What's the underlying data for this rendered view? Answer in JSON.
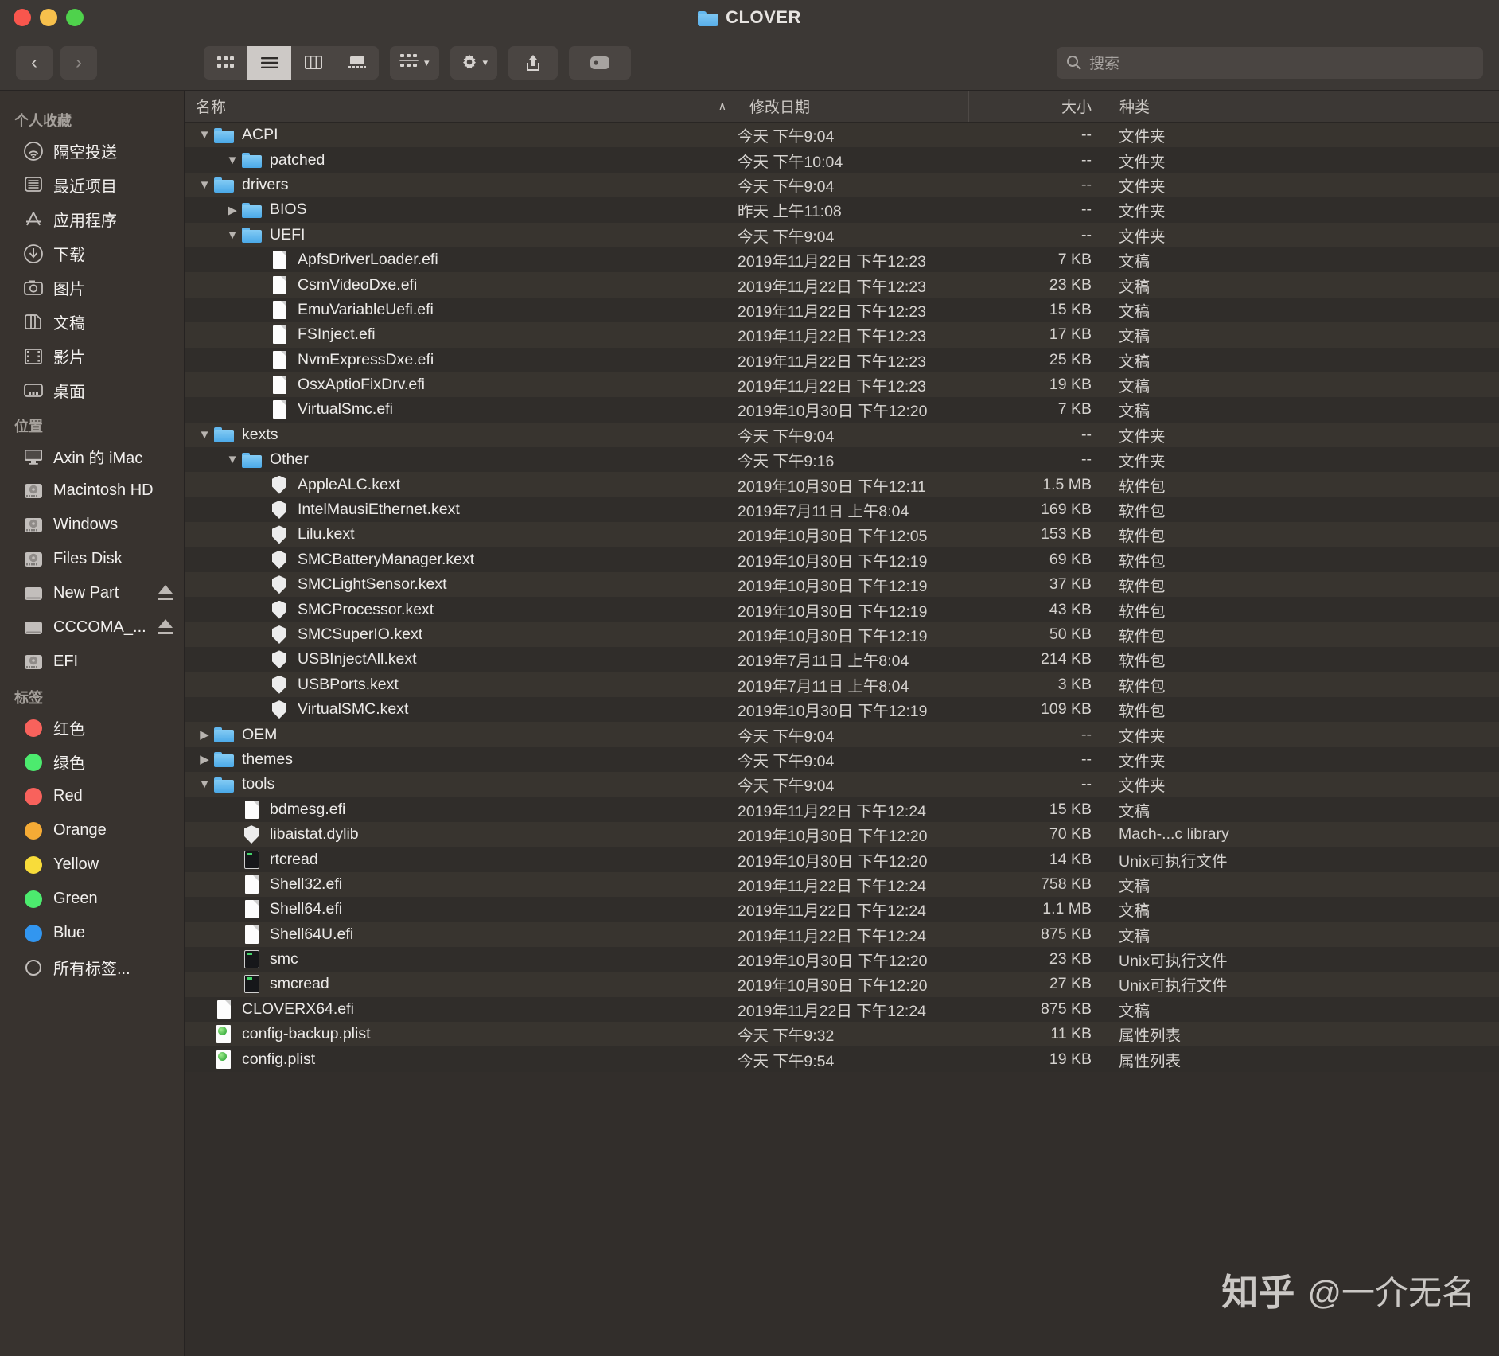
{
  "window": {
    "title": "CLOVER",
    "folder_icon": "folder-icon",
    "traffic_lights": [
      "close-red",
      "minimize-yellow",
      "maximize-green"
    ]
  },
  "toolbar": {
    "back_label": "‹",
    "forward_label": "›",
    "view_modes": [
      "icon-view",
      "list-view",
      "column-view",
      "gallery-view"
    ],
    "active_view": "list-view",
    "group_button": "group-by-button",
    "action_button": "action-gear-button",
    "share_button": "share-button",
    "tags_button": "tags-button",
    "search": {
      "placeholder": "搜索",
      "value": "",
      "icon": "search-icon"
    }
  },
  "sidebar": {
    "groups": [
      {
        "title": "个人收藏",
        "items": [
          {
            "label": "隔空投送",
            "icon": "airdrop-icon"
          },
          {
            "label": "最近项目",
            "icon": "recents-icon"
          },
          {
            "label": "应用程序",
            "icon": "applications-icon"
          },
          {
            "label": "下载",
            "icon": "downloads-icon"
          },
          {
            "label": "图片",
            "icon": "pictures-icon"
          },
          {
            "label": "文稿",
            "icon": "documents-icon"
          },
          {
            "label": "影片",
            "icon": "movies-icon"
          },
          {
            "label": "桌面",
            "icon": "desktop-icon"
          }
        ]
      },
      {
        "title": "位置",
        "items": [
          {
            "label": "Axin 的 iMac",
            "icon": "imac-icon",
            "eject": false
          },
          {
            "label": "Macintosh HD",
            "icon": "harddisk-icon",
            "eject": false
          },
          {
            "label": "Windows",
            "icon": "harddisk-icon",
            "eject": false
          },
          {
            "label": "Files Disk",
            "icon": "harddisk-icon",
            "eject": false
          },
          {
            "label": "New Part",
            "icon": "external-drive-icon",
            "eject": true
          },
          {
            "label": "CCCOMA_...",
            "icon": "external-drive-icon",
            "eject": true
          },
          {
            "label": "EFI",
            "icon": "harddisk-icon",
            "eject": false
          }
        ]
      },
      {
        "title": "标签",
        "items": [
          {
            "label": "红色",
            "icon": "tag-dot-icon",
            "color": "#f8625c"
          },
          {
            "label": "绿色",
            "icon": "tag-dot-icon",
            "color": "#4ceb6e"
          },
          {
            "label": "Red",
            "icon": "tag-dot-icon",
            "color": "#f8625c"
          },
          {
            "label": "Orange",
            "icon": "tag-dot-icon",
            "color": "#f5ab35"
          },
          {
            "label": "Yellow",
            "icon": "tag-dot-icon",
            "color": "#f8dc3a"
          },
          {
            "label": "Green",
            "icon": "tag-dot-icon",
            "color": "#4ceb6e"
          },
          {
            "label": "Blue",
            "icon": "tag-dot-icon",
            "color": "#3296f0"
          },
          {
            "label": "所有标签...",
            "icon": "all-tags-icon",
            "color": "none"
          }
        ]
      }
    ]
  },
  "columns": {
    "name": "名称",
    "date": "修改日期",
    "size": "大小",
    "kind": "种类",
    "sort_indicator": "∧",
    "sorted_by": "name"
  },
  "files": [
    {
      "name": "ACPI",
      "level": 0,
      "disclosure": "open",
      "icon": "folder-icon",
      "date": "今天 下午9:04",
      "size": "--",
      "kind": "文件夹"
    },
    {
      "name": "patched",
      "level": 1,
      "disclosure": "open",
      "icon": "folder-icon",
      "date": "今天 下午10:04",
      "size": "--",
      "kind": "文件夹"
    },
    {
      "name": "drivers",
      "level": 0,
      "disclosure": "open",
      "icon": "folder-icon",
      "date": "今天 下午9:04",
      "size": "--",
      "kind": "文件夹"
    },
    {
      "name": "BIOS",
      "level": 1,
      "disclosure": "closed",
      "icon": "folder-icon",
      "date": "昨天 上午11:08",
      "size": "--",
      "kind": "文件夹"
    },
    {
      "name": "UEFI",
      "level": 1,
      "disclosure": "open",
      "icon": "folder-icon",
      "date": "今天 下午9:04",
      "size": "--",
      "kind": "文件夹"
    },
    {
      "name": "ApfsDriverLoader.efi",
      "level": 2,
      "disclosure": "none",
      "icon": "document-icon",
      "date": "2019年11月22日 下午12:23",
      "size": "7 KB",
      "kind": "文稿"
    },
    {
      "name": "CsmVideoDxe.efi",
      "level": 2,
      "disclosure": "none",
      "icon": "document-icon",
      "date": "2019年11月22日 下午12:23",
      "size": "23 KB",
      "kind": "文稿"
    },
    {
      "name": "EmuVariableUefi.efi",
      "level": 2,
      "disclosure": "none",
      "icon": "document-icon",
      "date": "2019年11月22日 下午12:23",
      "size": "15 KB",
      "kind": "文稿"
    },
    {
      "name": "FSInject.efi",
      "level": 2,
      "disclosure": "none",
      "icon": "document-icon",
      "date": "2019年11月22日 下午12:23",
      "size": "17 KB",
      "kind": "文稿"
    },
    {
      "name": "NvmExpressDxe.efi",
      "level": 2,
      "disclosure": "none",
      "icon": "document-icon",
      "date": "2019年11月22日 下午12:23",
      "size": "25 KB",
      "kind": "文稿"
    },
    {
      "name": "OsxAptioFixDrv.efi",
      "level": 2,
      "disclosure": "none",
      "icon": "document-icon",
      "date": "2019年11月22日 下午12:23",
      "size": "19 KB",
      "kind": "文稿"
    },
    {
      "name": "VirtualSmc.efi",
      "level": 2,
      "disclosure": "none",
      "icon": "document-icon",
      "date": "2019年10月30日 下午12:20",
      "size": "7 KB",
      "kind": "文稿"
    },
    {
      "name": "kexts",
      "level": 0,
      "disclosure": "open",
      "icon": "folder-icon",
      "date": "今天 下午9:04",
      "size": "--",
      "kind": "文件夹"
    },
    {
      "name": "Other",
      "level": 1,
      "disclosure": "open",
      "icon": "folder-icon",
      "date": "今天 下午9:16",
      "size": "--",
      "kind": "文件夹"
    },
    {
      "name": "AppleALC.kext",
      "level": 2,
      "disclosure": "none",
      "icon": "kext-icon",
      "date": "2019年10月30日 下午12:11",
      "size": "1.5 MB",
      "kind": "软件包"
    },
    {
      "name": "IntelMausiEthernet.kext",
      "level": 2,
      "disclosure": "none",
      "icon": "kext-icon",
      "date": "2019年7月11日 上午8:04",
      "size": "169 KB",
      "kind": "软件包"
    },
    {
      "name": "Lilu.kext",
      "level": 2,
      "disclosure": "none",
      "icon": "kext-icon",
      "date": "2019年10月30日 下午12:05",
      "size": "153 KB",
      "kind": "软件包"
    },
    {
      "name": "SMCBatteryManager.kext",
      "level": 2,
      "disclosure": "none",
      "icon": "kext-icon",
      "date": "2019年10月30日 下午12:19",
      "size": "69 KB",
      "kind": "软件包"
    },
    {
      "name": "SMCLightSensor.kext",
      "level": 2,
      "disclosure": "none",
      "icon": "kext-icon",
      "date": "2019年10月30日 下午12:19",
      "size": "37 KB",
      "kind": "软件包"
    },
    {
      "name": "SMCProcessor.kext",
      "level": 2,
      "disclosure": "none",
      "icon": "kext-icon",
      "date": "2019年10月30日 下午12:19",
      "size": "43 KB",
      "kind": "软件包"
    },
    {
      "name": "SMCSuperIO.kext",
      "level": 2,
      "disclosure": "none",
      "icon": "kext-icon",
      "date": "2019年10月30日 下午12:19",
      "size": "50 KB",
      "kind": "软件包"
    },
    {
      "name": "USBInjectAll.kext",
      "level": 2,
      "disclosure": "none",
      "icon": "kext-icon",
      "date": "2019年7月11日 上午8:04",
      "size": "214 KB",
      "kind": "软件包"
    },
    {
      "name": "USBPorts.kext",
      "level": 2,
      "disclosure": "none",
      "icon": "kext-icon",
      "date": "2019年7月11日 上午8:04",
      "size": "3 KB",
      "kind": "软件包"
    },
    {
      "name": "VirtualSMC.kext",
      "level": 2,
      "disclosure": "none",
      "icon": "kext-icon",
      "date": "2019年10月30日 下午12:19",
      "size": "109 KB",
      "kind": "软件包"
    },
    {
      "name": "OEM",
      "level": 0,
      "disclosure": "closed",
      "icon": "folder-icon",
      "date": "今天 下午9:04",
      "size": "--",
      "kind": "文件夹"
    },
    {
      "name": "themes",
      "level": 0,
      "disclosure": "closed",
      "icon": "folder-icon",
      "date": "今天 下午9:04",
      "size": "--",
      "kind": "文件夹"
    },
    {
      "name": "tools",
      "level": 0,
      "disclosure": "open",
      "icon": "folder-icon",
      "date": "今天 下午9:04",
      "size": "--",
      "kind": "文件夹"
    },
    {
      "name": "bdmesg.efi",
      "level": 1,
      "disclosure": "none",
      "icon": "document-icon",
      "date": "2019年11月22日 下午12:24",
      "size": "15 KB",
      "kind": "文稿"
    },
    {
      "name": "libaistat.dylib",
      "level": 1,
      "disclosure": "none",
      "icon": "kext-icon",
      "date": "2019年10月30日 下午12:20",
      "size": "70 KB",
      "kind": "Mach-...c library"
    },
    {
      "name": "rtcread",
      "level": 1,
      "disclosure": "none",
      "icon": "unix-executable-icon",
      "date": "2019年10月30日 下午12:20",
      "size": "14 KB",
      "kind": "Unix可执行文件"
    },
    {
      "name": "Shell32.efi",
      "level": 1,
      "disclosure": "none",
      "icon": "document-icon",
      "date": "2019年11月22日 下午12:24",
      "size": "758 KB",
      "kind": "文稿"
    },
    {
      "name": "Shell64.efi",
      "level": 1,
      "disclosure": "none",
      "icon": "document-icon",
      "date": "2019年11月22日 下午12:24",
      "size": "1.1 MB",
      "kind": "文稿"
    },
    {
      "name": "Shell64U.efi",
      "level": 1,
      "disclosure": "none",
      "icon": "document-icon",
      "date": "2019年11月22日 下午12:24",
      "size": "875 KB",
      "kind": "文稿"
    },
    {
      "name": "smc",
      "level": 1,
      "disclosure": "none",
      "icon": "unix-executable-icon",
      "date": "2019年10月30日 下午12:20",
      "size": "23 KB",
      "kind": "Unix可执行文件"
    },
    {
      "name": "smcread",
      "level": 1,
      "disclosure": "none",
      "icon": "unix-executable-icon",
      "date": "2019年10月30日 下午12:20",
      "size": "27 KB",
      "kind": "Unix可执行文件"
    },
    {
      "name": "CLOVERX64.efi",
      "level": 0,
      "disclosure": "none",
      "icon": "document-icon",
      "date": "2019年11月22日 下午12:24",
      "size": "875 KB",
      "kind": "文稿"
    },
    {
      "name": "config-backup.plist",
      "level": 0,
      "disclosure": "none",
      "icon": "plist-icon",
      "date": "今天 下午9:32",
      "size": "11 KB",
      "kind": "属性列表"
    },
    {
      "name": "config.plist",
      "level": 0,
      "disclosure": "none",
      "icon": "plist-icon",
      "date": "今天 下午9:54",
      "size": "19 KB",
      "kind": "属性列表"
    }
  ],
  "watermark": {
    "site": "知乎",
    "user": "@一介无名"
  }
}
